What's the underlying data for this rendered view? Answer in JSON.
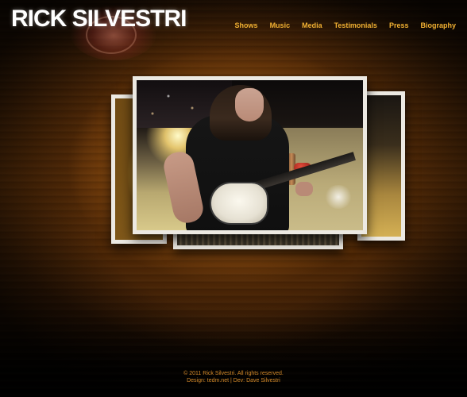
{
  "site": {
    "name": "RICK SILVESTRI"
  },
  "nav": {
    "items": [
      {
        "label": "Shows"
      },
      {
        "label": "Music"
      },
      {
        "label": "Media"
      },
      {
        "label": "Testimonials"
      },
      {
        "label": "Press"
      },
      {
        "label": "Biography"
      }
    ]
  },
  "colors": {
    "nav_link": "#f2b132",
    "footer_text": "#d48a2a",
    "logo": "#ffffff"
  },
  "footer": {
    "copyright": "© 2011 Rick Silvestri. All rights reserved.",
    "credits": "Design: tedm.net | Dev: Dave Silvestri"
  }
}
